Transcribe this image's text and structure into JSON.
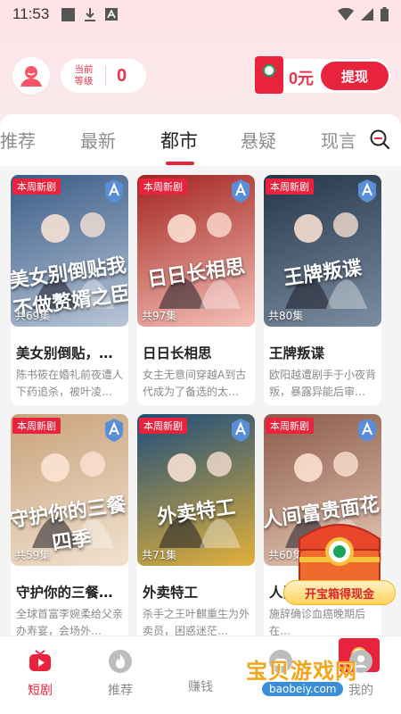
{
  "status_bar": {
    "time": "11:53"
  },
  "header": {
    "level_label": "当前等级",
    "level_value": "0",
    "money": "0元",
    "withdraw_label": "提现"
  },
  "tabs": [
    {
      "label": "推荐"
    },
    {
      "label": "最新"
    },
    {
      "label": "都市"
    },
    {
      "label": "悬疑"
    },
    {
      "label": "现言"
    }
  ],
  "active_tab": "都市",
  "cards": [
    {
      "badge": "本周新剧",
      "episodes": "共69集",
      "poster_text": "美女别倒贴我不做赘婿之臣",
      "title": "美女别倒贴，…",
      "desc": "陈书筱在婚礼前夜遭人下药追杀，被叶凌…",
      "poster_colors": [
        "#3a5c86",
        "#b9c6d8"
      ]
    },
    {
      "badge": "本周新剧",
      "episodes": "共97集",
      "poster_text": "日日长相思",
      "title": "日日长相思",
      "desc": "女主无意间穿越A到古代成为了备选的太…",
      "poster_colors": [
        "#a3231f",
        "#f5c1b8"
      ]
    },
    {
      "badge": "本周新剧",
      "episodes": "共80集",
      "poster_text": "王牌叛谍",
      "title": "王牌叛谍",
      "desc": "欧阳越遭剧手于小夜背叛，暴露异能后审…",
      "poster_colors": [
        "#253548",
        "#7c8ea2"
      ]
    },
    {
      "badge": "本周新剧",
      "episodes": "共59集",
      "poster_text": "守护你的三餐四季",
      "title": "守护你的三餐…",
      "desc": "全球首富李婉柔给父亲办寿宴，会场外…",
      "poster_colors": [
        "#c9a27c",
        "#f1e2cf"
      ]
    },
    {
      "badge": "本周新剧",
      "episodes": "共71集",
      "poster_text": "外卖特工",
      "title": "外卖特工",
      "desc": "杀手之王叶麒重生为外卖员，困惑迷茫…",
      "poster_colors": [
        "#1d4d7a",
        "#e2b13a"
      ]
    },
    {
      "badge": "本周新剧",
      "episodes": "共60集",
      "poster_text": "人间富贵面花花",
      "title": "人间…",
      "desc": "施辞确诊血癌晚期后在…",
      "poster_colors": [
        "#8a5a4a",
        "#e8c9b7"
      ]
    }
  ],
  "treasure": {
    "label": "开宝箱得现金"
  },
  "bottom_nav": [
    {
      "label": "短剧",
      "icon": "play-tv-icon"
    },
    {
      "label": "推荐",
      "icon": "fire-icon"
    },
    {
      "label": "赚钱",
      "icon": "red-packet-icon"
    },
    {
      "label": "",
      "icon": "game-icon"
    },
    {
      "label": "我的",
      "icon": "profile-icon"
    }
  ],
  "watermark": {
    "text": "宝贝游戏网",
    "url": "baobeiy.com"
  },
  "colors": {
    "accent": "#e8233e",
    "muted": "#8c8c8c"
  }
}
